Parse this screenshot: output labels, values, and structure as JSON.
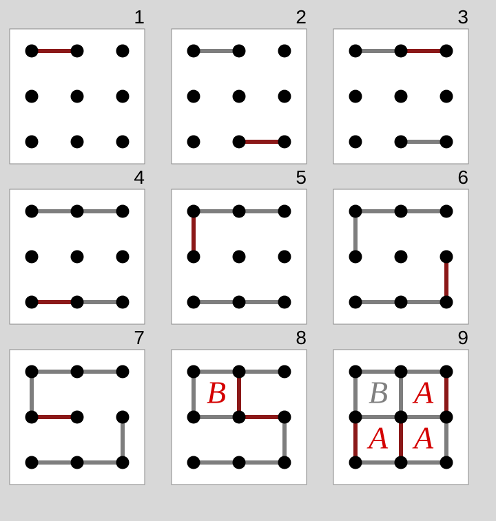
{
  "grid": {
    "cols": 3,
    "rows": 3,
    "points": [
      0,
      1,
      2
    ]
  },
  "panels": [
    {
      "num": "1",
      "grey": [],
      "red": [
        [
          0,
          0,
          1,
          0
        ]
      ],
      "labels": []
    },
    {
      "num": "2",
      "grey": [
        [
          0,
          0,
          1,
          0
        ]
      ],
      "red": [
        [
          1,
          2,
          2,
          2
        ]
      ],
      "labels": []
    },
    {
      "num": "3",
      "grey": [
        [
          0,
          0,
          1,
          0
        ],
        [
          1,
          2,
          2,
          2
        ]
      ],
      "red": [
        [
          1,
          0,
          2,
          0
        ]
      ],
      "labels": []
    },
    {
      "num": "4",
      "grey": [
        [
          0,
          0,
          1,
          0
        ],
        [
          1,
          0,
          2,
          0
        ],
        [
          1,
          2,
          2,
          2
        ]
      ],
      "red": [
        [
          0,
          2,
          1,
          2
        ]
      ],
      "labels": []
    },
    {
      "num": "5",
      "grey": [
        [
          0,
          0,
          1,
          0
        ],
        [
          1,
          0,
          2,
          0
        ],
        [
          0,
          2,
          1,
          2
        ],
        [
          1,
          2,
          2,
          2
        ]
      ],
      "red": [
        [
          0,
          0,
          0,
          1
        ]
      ],
      "labels": []
    },
    {
      "num": "6",
      "grey": [
        [
          0,
          0,
          1,
          0
        ],
        [
          1,
          0,
          2,
          0
        ],
        [
          0,
          2,
          1,
          2
        ],
        [
          1,
          2,
          2,
          2
        ],
        [
          0,
          0,
          0,
          1
        ]
      ],
      "red": [
        [
          2,
          1,
          2,
          2
        ]
      ],
      "labels": []
    },
    {
      "num": "7",
      "grey": [
        [
          0,
          0,
          1,
          0
        ],
        [
          1,
          0,
          2,
          0
        ],
        [
          0,
          2,
          1,
          2
        ],
        [
          1,
          2,
          2,
          2
        ],
        [
          0,
          0,
          0,
          1
        ],
        [
          2,
          1,
          2,
          2
        ]
      ],
      "red": [
        [
          0,
          1,
          1,
          1
        ]
      ],
      "labels": []
    },
    {
      "num": "8",
      "grey": [
        [
          0,
          0,
          1,
          0
        ],
        [
          1,
          0,
          2,
          0
        ],
        [
          0,
          2,
          1,
          2
        ],
        [
          1,
          2,
          2,
          2
        ],
        [
          0,
          0,
          0,
          1
        ],
        [
          2,
          1,
          2,
          2
        ],
        [
          0,
          1,
          1,
          1
        ]
      ],
      "red": [
        [
          1,
          0,
          1,
          1
        ],
        [
          1,
          1,
          2,
          1
        ]
      ],
      "labels": [
        {
          "text": "B",
          "cls": "letterBred",
          "cell": [
            0,
            0
          ]
        }
      ]
    },
    {
      "num": "9",
      "grey": [
        [
          0,
          0,
          1,
          0
        ],
        [
          1,
          0,
          2,
          0
        ],
        [
          0,
          2,
          1,
          2
        ],
        [
          1,
          2,
          2,
          2
        ],
        [
          0,
          0,
          0,
          1
        ],
        [
          2,
          1,
          2,
          2
        ],
        [
          0,
          1,
          1,
          1
        ],
        [
          1,
          0,
          1,
          1
        ],
        [
          1,
          1,
          2,
          1
        ]
      ],
      "red": [
        [
          2,
          0,
          2,
          1
        ],
        [
          0,
          1,
          0,
          2
        ],
        [
          1,
          1,
          1,
          2
        ]
      ],
      "labels": [
        {
          "text": "B",
          "cls": "letterBgrey",
          "cell": [
            0,
            0
          ]
        },
        {
          "text": "A",
          "cls": "letterA",
          "cell": [
            1,
            0
          ]
        },
        {
          "text": "A",
          "cls": "letterA",
          "cell": [
            0,
            1
          ]
        },
        {
          "text": "A",
          "cls": "letterA",
          "cell": [
            1,
            1
          ]
        }
      ]
    }
  ]
}
